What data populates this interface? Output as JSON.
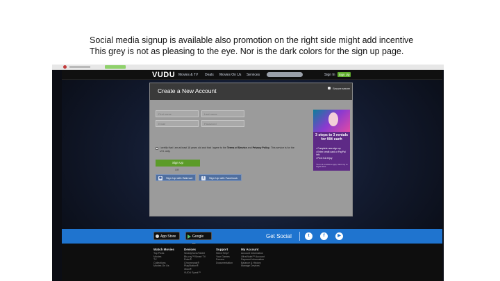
{
  "caption": {
    "line1": "Social media signup is available also promotion on the right side might add incentive",
    "line2": "This grey is not as pleasing to the eye. Nor is the dark colors for the sign up page."
  },
  "nav": {
    "logo": "VUDU",
    "links": [
      "Movies & TV",
      "Deals",
      "Movies On Us",
      "Services"
    ],
    "signin": "Sign In",
    "join": "Sign Up"
  },
  "form": {
    "title": "Create a New Account",
    "secure": "Secure server",
    "first_name": "First name",
    "last_name": "Last name",
    "email": "Email",
    "password": "Password",
    "terms_pre": "I certify that I am at least 18 years old and that I agree to the ",
    "terms_link1": "Terms of Service",
    "terms_mid": " and ",
    "terms_link2": "Privacy Policy",
    "terms_post": ". This service is for the U.S. only.",
    "signup": "Sign Up",
    "or": "OR",
    "walmart": "Sign Up with Walmart",
    "facebook": "Sign Up with Facebook"
  },
  "promo": {
    "headline": "3 steps to 3 rentals for 99¢ each",
    "steps": [
      "• Complete new sign up",
      "• Enter credit card or PayPal info",
      "• Pick 3 & enjoy"
    ],
    "fine": "*Terms & conditions apply. Valid only on eligible titles."
  },
  "band": {
    "appstore": "App Store",
    "googleplay": "Google Play",
    "get_social": "Get Social"
  },
  "footer": {
    "cols": [
      {
        "head": "Watch Movies",
        "items": [
          "Top Picks",
          "Movies",
          "TV",
          "Collections",
          "Movies On Us"
        ]
      },
      {
        "head": "Devices",
        "items": [
          "Smartphone/Tablet",
          "Blu-ray™/Smart TV",
          "Roku®",
          "Chromecast®",
          "PlayStation®",
          "Xbox®",
          "VUDU Spark™"
        ]
      },
      {
        "head": "Support",
        "items": [
          "Need Help?",
          "Your Games",
          "Forums",
          "Documentation"
        ]
      },
      {
        "head": "My Account",
        "items": [
          "Account Information",
          "UltraViolet™ Account",
          "Payment Information",
          "Balance & History",
          "Manage Devices"
        ]
      }
    ]
  },
  "colors": {
    "nav_bg": "#101010",
    "card_bg": "#9b9b9b",
    "card_header": "#3a3a3a",
    "signup_green": "#5b9b28",
    "social_band": "#1f74cf",
    "promo_purple": "#5e2a86"
  }
}
